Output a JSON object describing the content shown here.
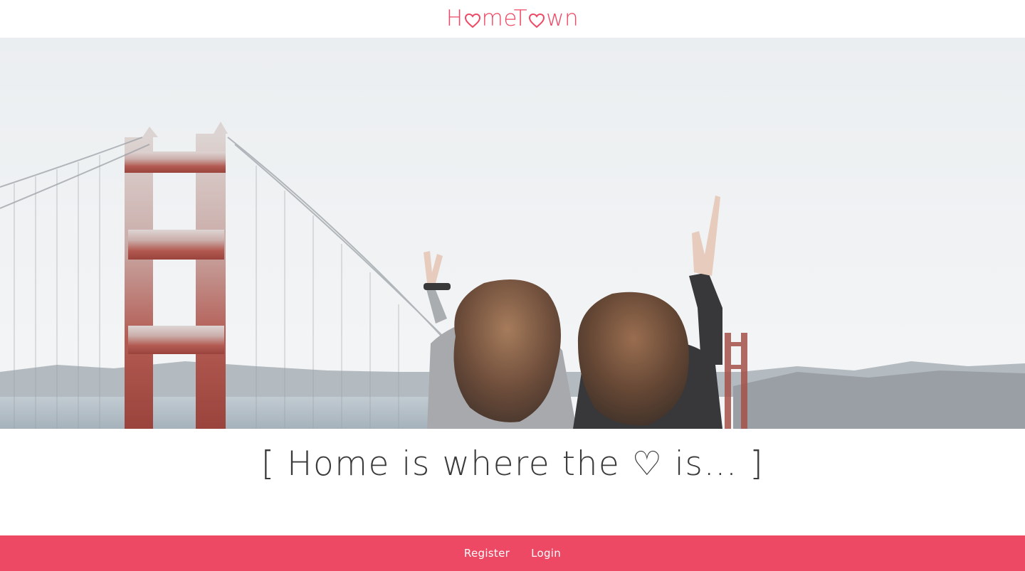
{
  "brand": {
    "logo_part1": "H",
    "logo_part2": "meT",
    "logo_part3": "wn",
    "logo_full": "HomeTown",
    "accent_color": "#ee4964"
  },
  "hero": {
    "image_description": "two women raising peace signs in front of a foggy Golden Gate Bridge"
  },
  "tagline": {
    "text": "[ Home is where the ♡ is… ]"
  },
  "footer": {
    "background": "#ee4964",
    "links": [
      {
        "label": "Register",
        "icon": ""
      },
      {
        "label": "Login",
        "icon": ""
      }
    ]
  }
}
